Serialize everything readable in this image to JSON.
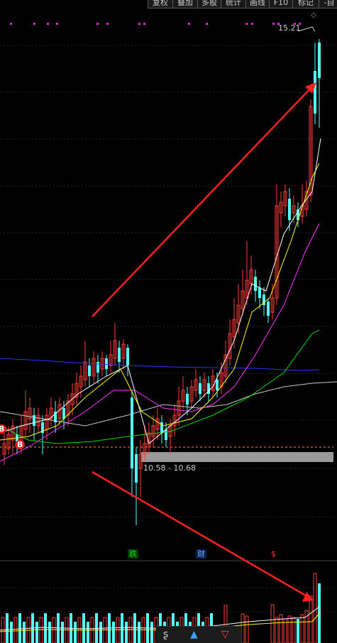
{
  "toolbar": {
    "buttons": [
      "复权",
      "叠加",
      "多股",
      "统计",
      "画线",
      "F10",
      "标记",
      "-自"
    ]
  },
  "chart": {
    "high_price": "15.21",
    "range_label": "10.58 - 10.68",
    "markers": {
      "fall": "跌",
      "finance": "财",
      "dollar": "$",
      "buy": "B"
    },
    "colors": {
      "up": "#ff3b3b",
      "down": "#54ffff",
      "ma5": "#ffffff",
      "ma10": "#ffff00",
      "ma20": "#ff33ff",
      "ma60": "#00dd00",
      "ma120": "#c8c8c8",
      "ma250": "#3030ff",
      "arrow": "#ff2020"
    }
  },
  "bottom_icons": [
    "wave-icon",
    "triangle-icon",
    "cancel-icon"
  ]
}
